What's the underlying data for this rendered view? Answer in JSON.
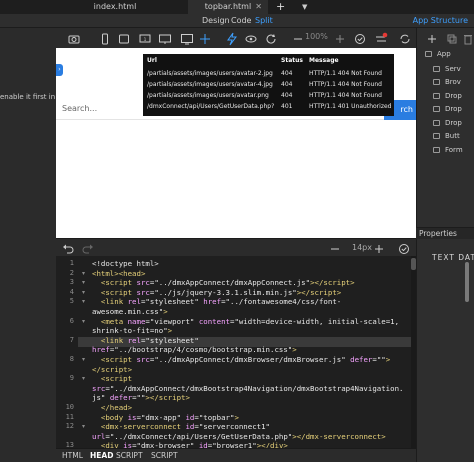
{
  "tabs": [
    {
      "label": "index.html"
    },
    {
      "label": "topbar.html"
    }
  ],
  "modes": {
    "design": "Design",
    "code": "Code",
    "split": "Split"
  },
  "app_structure_label": "App Structure",
  "toolbar": {
    "zoom": "100%"
  },
  "design_view": {
    "hint_text": "enable it first in",
    "chip_label": "›",
    "search_placeholder": "Search...",
    "search_button": "rch"
  },
  "network_popup": {
    "headers": {
      "url": "Url",
      "status": "Status",
      "message": "Message"
    },
    "rows": [
      {
        "url": "/partials/assets/images/users/avatar-2.jpg",
        "status": "404",
        "message": "HTTP/1.1 404 Not Found"
      },
      {
        "url": "/partials/assets/images/users/avatar-4.jpg",
        "status": "404",
        "message": "HTTP/1.1 404 Not Found"
      },
      {
        "url": "/partials/assets/images/users/avatar.png",
        "status": "404",
        "message": "HTTP/1.1 404 Not Found"
      },
      {
        "url": "/dmxConnect/api/Users/GetUserData.php?",
        "status": "401",
        "message": "HTTP/1.1 401 Unauthorized"
      }
    ]
  },
  "editor_toolbar": {
    "font_size": "14px"
  },
  "code_lines": [
    {
      "num": "1",
      "html": "&lt;!doctype html&gt;"
    },
    {
      "num": "2",
      "html": "<span class='t'>&lt;html&gt;&lt;head&gt;</span>"
    },
    {
      "num": "3",
      "html": "  <span class='t'>&lt;script</span> <span class='a'>src</span>=<span class='s'>\"../dmxAppConnect/dmxAppConnect.js\"</span><span class='t'>&gt;&lt;/script&gt;</span>"
    },
    {
      "num": "4",
      "html": "  <span class='t'>&lt;script</span> <span class='a'>src</span>=<span class='s'>\"../js/jquery-3.3.1.slim.min.js\"</span><span class='t'>&gt;&lt;/script&gt;</span>"
    },
    {
      "num": "5",
      "html": "  <span class='t'>&lt;link</span> <span class='a'>rel</span>=<span class='s'>\"stylesheet\"</span> <span class='a'>href</span>=<span class='s'>\"../fontawesome4/css/font-</span>"
    },
    {
      "num": "",
      "html": "awesome.min.css\"<span class='t'>&gt;</span>"
    },
    {
      "num": "6",
      "html": "  <span class='t'>&lt;meta</span> <span class='a'>name</span>=<span class='s'>\"viewport\"</span> <span class='a'>content</span>=<span class='s'>\"width=device-width, initial-scale=1,</span>"
    },
    {
      "num": "",
      "html": "<span class='s'>shrink-to-fit=no\"</span><span class='t'>&gt;</span>"
    },
    {
      "num": "7",
      "html": "  <span class='t'>&lt;link</span> <span class='a'>rel</span>=<span class='s'>\"stylesheet\"</span>"
    },
    {
      "num": "",
      "html": "<span class='a'>href</span>=<span class='s'>\"../bootstrap/4/cosmo/bootstrap.min.css\"</span><span class='t'>&gt;</span>"
    },
    {
      "num": "8",
      "html": "  <span class='t'>&lt;script</span> <span class='a'>src</span>=<span class='s'>\"../dmxAppConnect/dmxBrowser/dmxBrowser.js\"</span> <span class='a'>defer</span>=<span class='s'>\"\"</span><span class='t'>&gt;</span>"
    },
    {
      "num": "",
      "html": "<span class='t'>&lt;/script&gt;</span>"
    },
    {
      "num": "9",
      "html": "  <span class='t'>&lt;script</span>"
    },
    {
      "num": "",
      "html": "<span class='a'>src</span>=<span class='s'>\"../dmxAppConnect/dmxBootstrap4Navigation/dmxBootstrap4Navigation.</span>"
    },
    {
      "num": "",
      "html": "<span class='s'>js\"</span> <span class='a'>defer</span>=<span class='s'>\"\"</span><span class='t'>&gt;&lt;/script&gt;</span>"
    },
    {
      "num": "10",
      "html": "  <span class='t'>&lt;/head&gt;</span>"
    },
    {
      "num": "11",
      "html": "  <span class='t'>&lt;body</span> <span class='a'>is</span>=<span class='s'>\"dmx-app\"</span> <span class='a'>id</span>=<span class='s'>\"topbar\"</span><span class='t'>&gt;</span>"
    },
    {
      "num": "12",
      "html": "  <span class='t'>&lt;dmx-serverconnect</span> <span class='a'>id</span>=<span class='s'>\"serverconnect1\"</span>"
    },
    {
      "num": "",
      "html": "<span class='a'>url</span>=<span class='s'>\"../dmxConnect/api/Users/GetUserData.php\"</span><span class='t'>&gt;&lt;/dmx-serverconnect&gt;</span>"
    },
    {
      "num": "13",
      "html": "  <span class='t'>&lt;div</span> <span class='a'>is</span>=<span class='s'>\"dmx-browser\"</span> <span class='a'>id</span>=<span class='s'>\"browser1\"</span><span class='t'>&gt;&lt;/div&gt;</span>"
    }
  ],
  "footer": [
    "HTML",
    "HEAD",
    "SCRIPT",
    "SCRIPT"
  ],
  "right_panel": {
    "tree": [
      "App",
      "Serv",
      "Brov",
      "Drop",
      "Drop",
      "Drop",
      "Butt",
      "Form"
    ],
    "properties_label": "Properties",
    "text_data_label": "TEXT DAT"
  }
}
